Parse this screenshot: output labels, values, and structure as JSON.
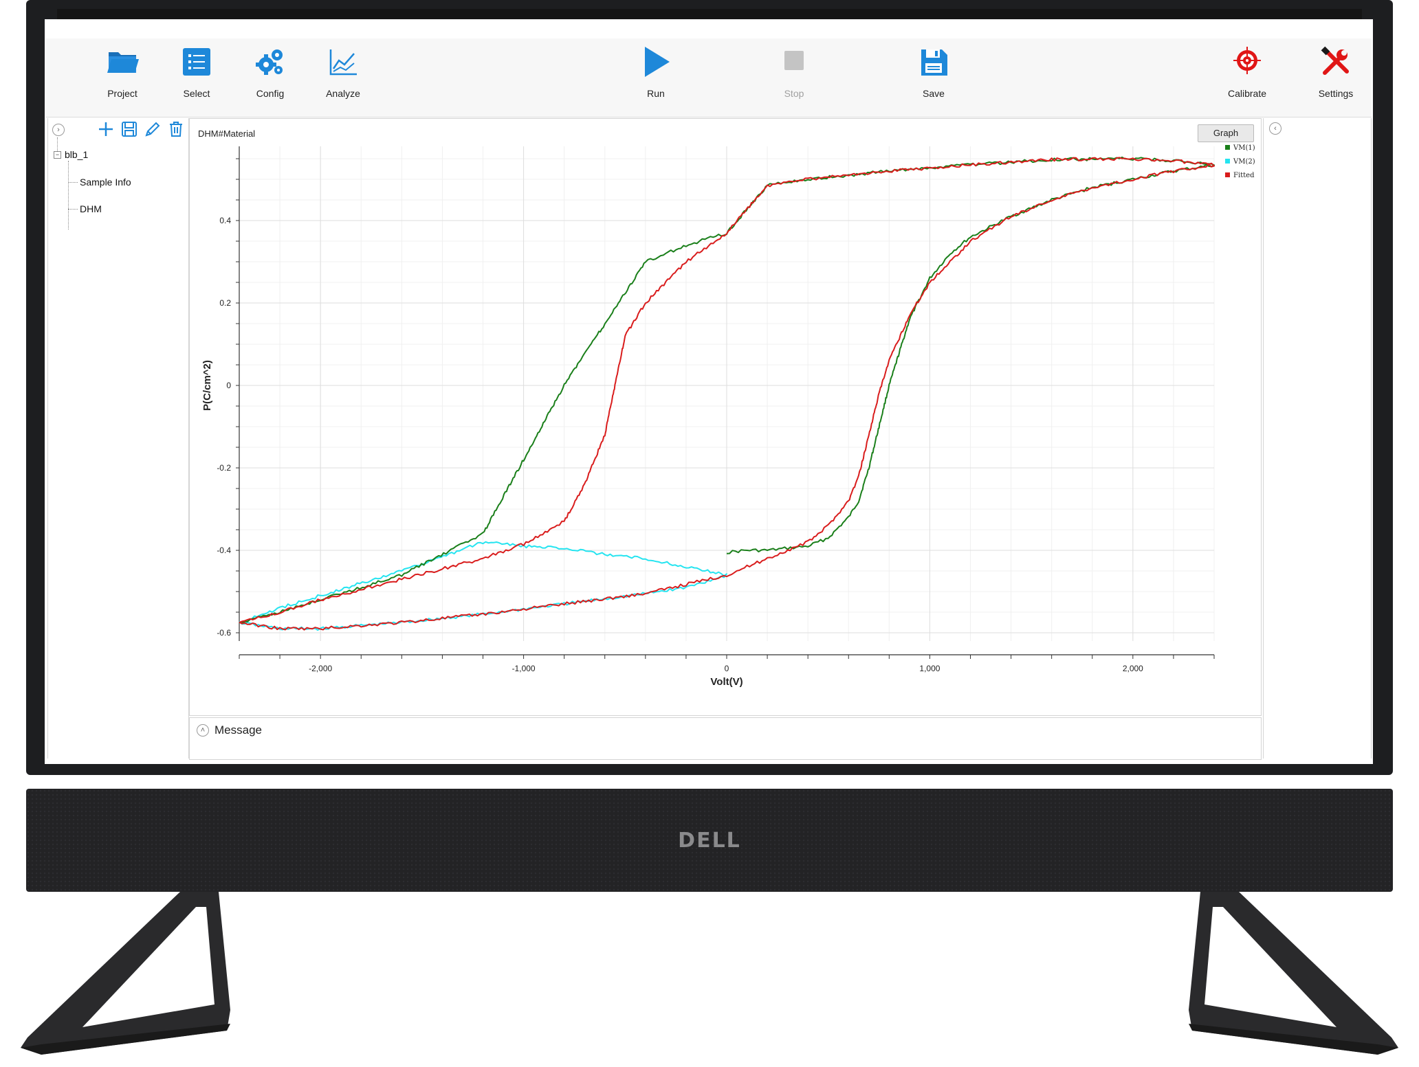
{
  "monitor": {
    "brand": "DELL"
  },
  "toolbar": {
    "project": "Project",
    "select": "Select",
    "config": "Config",
    "analyze": "Analyze",
    "run": "Run",
    "stop": "Stop",
    "save": "Save",
    "calibrate": "Calibrate",
    "settings": "Settings"
  },
  "tree": {
    "root": "blb_1",
    "children": [
      "Sample Info",
      "DHM"
    ]
  },
  "main": {
    "tab_title": "DHM#Material",
    "graph_button": "Graph"
  },
  "message": {
    "label": "Message"
  },
  "colors": {
    "accent": "#1e88d9",
    "series_1": "#1a7f1a",
    "series_2": "#25e4f0",
    "fitted": "#d91c1c",
    "stop_disabled": "#c4c4c4",
    "calibrate": "#e01616"
  },
  "chart_data": {
    "type": "line",
    "xlabel": "Volt(V)",
    "ylabel": "P(C/cm^2)",
    "xlim": [
      -2400,
      2400
    ],
    "ylim": [
      -0.62,
      0.58
    ],
    "x_ticks": [
      -2000,
      -1000,
      0,
      1000,
      2000
    ],
    "x_tick_labels": [
      "-2,000",
      "-1,000",
      "0",
      "1,000",
      "2,000"
    ],
    "y_ticks": [
      -0.6,
      -0.4,
      -0.2,
      0,
      0.2,
      0.4
    ],
    "y_tick_labels": [
      "-0.6",
      "-0.4",
      "-0.2",
      "0",
      "0.2",
      "0.4"
    ],
    "grid": true,
    "legend_position": "top-right",
    "series": [
      {
        "name": "VM(1)",
        "color": "#1a7f1a",
        "x": [
          0,
          100,
          200,
          300,
          400,
          500,
          600,
          650,
          700,
          750,
          800,
          850,
          900,
          1000,
          1100,
          1200,
          1400,
          1600,
          1800,
          2000,
          2200,
          2400,
          2200,
          2000,
          1600,
          1200,
          800,
          400,
          200,
          0,
          -200,
          -400,
          -800,
          -1200,
          -1600,
          -2000,
          -2200,
          -2400
        ],
        "y": [
          -0.405,
          -0.4,
          -0.4,
          -0.395,
          -0.39,
          -0.37,
          -0.32,
          -0.28,
          -0.2,
          -0.1,
          0.0,
          0.08,
          0.16,
          0.26,
          0.32,
          0.36,
          0.41,
          0.45,
          0.48,
          0.5,
          0.52,
          0.535,
          0.545,
          0.55,
          0.548,
          0.535,
          0.52,
          0.5,
          0.485,
          0.37,
          0.34,
          0.3,
          0.0,
          -0.36,
          -0.46,
          -0.52,
          -0.55,
          -0.575
        ]
      },
      {
        "name": "VM(2)",
        "color": "#25e4f0",
        "x": [
          -2400,
          -2200,
          -2000,
          -1600,
          -1200,
          -800,
          -400,
          -200,
          0,
          -200,
          -400,
          -600,
          -800,
          -1000,
          -1200,
          -1600,
          -2000,
          -2200,
          -2400
        ],
        "y": [
          -0.575,
          -0.59,
          -0.59,
          -0.575,
          -0.555,
          -0.53,
          -0.505,
          -0.49,
          -0.46,
          -0.44,
          -0.42,
          -0.41,
          -0.395,
          -0.39,
          -0.38,
          -0.45,
          -0.51,
          -0.54,
          -0.575
        ]
      },
      {
        "name": "Fitted",
        "color": "#d91c1c",
        "x": [
          -2400,
          -2200,
          -2000,
          -1600,
          -1200,
          -800,
          -400,
          0,
          200,
          400,
          500,
          600,
          650,
          700,
          750,
          800,
          900,
          1000,
          1100,
          1200,
          1400,
          1600,
          1800,
          2000,
          2200,
          2400,
          2200,
          2000,
          1600,
          1200,
          800,
          400,
          200,
          0,
          -200,
          -300,
          -400,
          -500,
          -550,
          -600,
          -700,
          -800,
          -1000,
          -1200,
          -1600,
          -2000,
          -2200,
          -2400
        ],
        "y": [
          -0.575,
          -0.59,
          -0.59,
          -0.575,
          -0.555,
          -0.53,
          -0.505,
          -0.46,
          -0.42,
          -0.38,
          -0.34,
          -0.28,
          -0.22,
          -0.12,
          -0.02,
          0.06,
          0.17,
          0.25,
          0.3,
          0.35,
          0.41,
          0.45,
          0.48,
          0.5,
          0.52,
          0.535,
          0.545,
          0.55,
          0.548,
          0.535,
          0.52,
          0.5,
          0.485,
          0.37,
          0.3,
          0.25,
          0.2,
          0.12,
          0.0,
          -0.12,
          -0.24,
          -0.33,
          -0.385,
          -0.42,
          -0.47,
          -0.52,
          -0.55,
          -0.575
        ]
      }
    ]
  }
}
